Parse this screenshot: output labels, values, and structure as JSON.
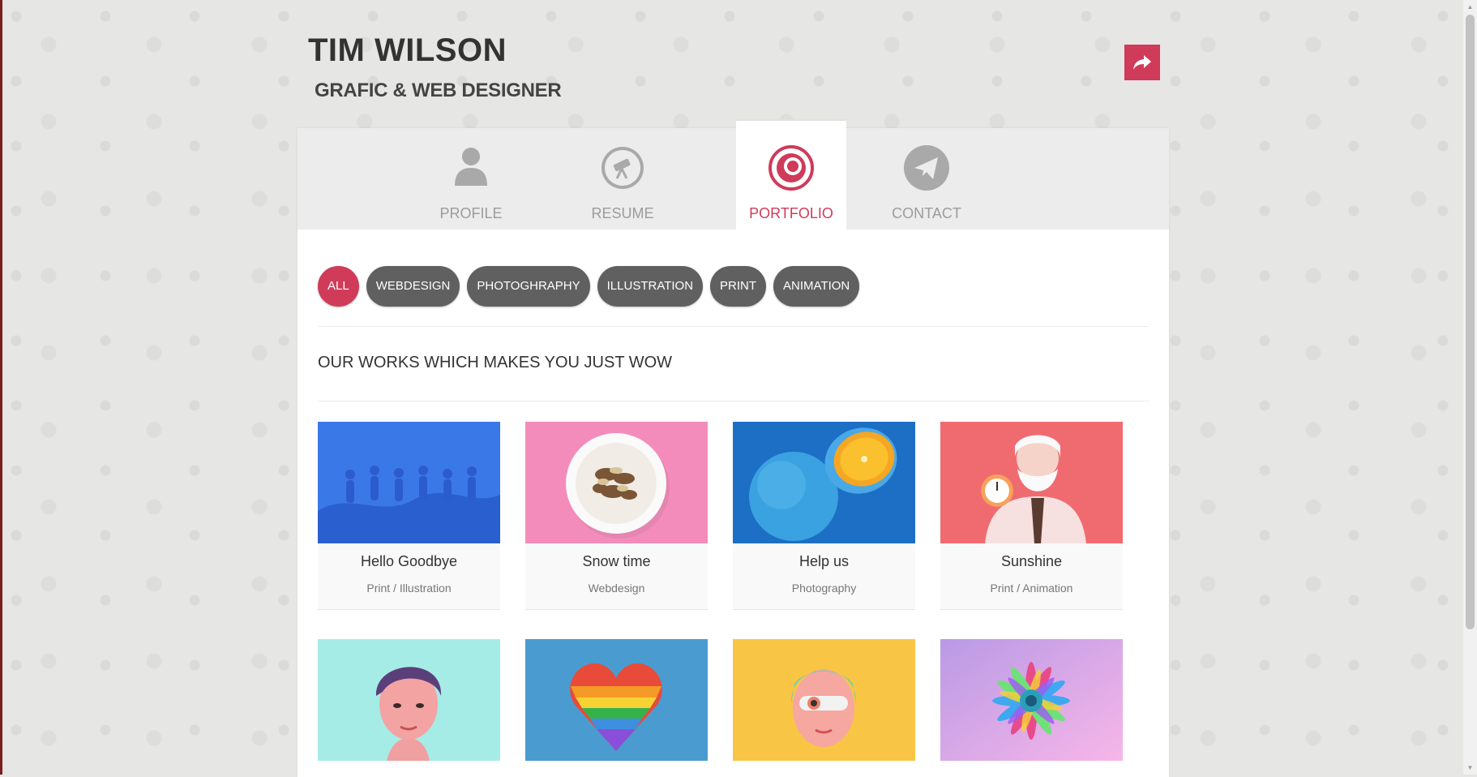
{
  "header": {
    "name": "TIM WILSON",
    "role": "GRAFIC & WEB DESIGNER"
  },
  "tabs": [
    {
      "label": "PROFILE",
      "icon": "user-icon"
    },
    {
      "label": "RESUME",
      "icon": "telescope-icon"
    },
    {
      "label": "PORTFOLIO",
      "icon": "target-icon",
      "active": true
    },
    {
      "label": "CONTACT",
      "icon": "paper-plane-icon"
    }
  ],
  "filters": [
    "ALL",
    "WEBDESIGN",
    "PHOTOGHRAPHY",
    "ILLUSTRATION",
    "PRINT",
    "ANIMATION"
  ],
  "section_title": "OUR WORKS WHICH MAKES YOU JUST WOW",
  "works": [
    {
      "title": "Hello Goodbye",
      "category": "Print / Illustration"
    },
    {
      "title": "Snow time",
      "category": "Webdesign"
    },
    {
      "title": "Help us",
      "category": "Photography"
    },
    {
      "title": "Sunshine",
      "category": "Print / Animation"
    }
  ],
  "colors": {
    "accent": "#d03b5a",
    "filter_bg": "#606060",
    "tab_bar": "#ececec"
  }
}
